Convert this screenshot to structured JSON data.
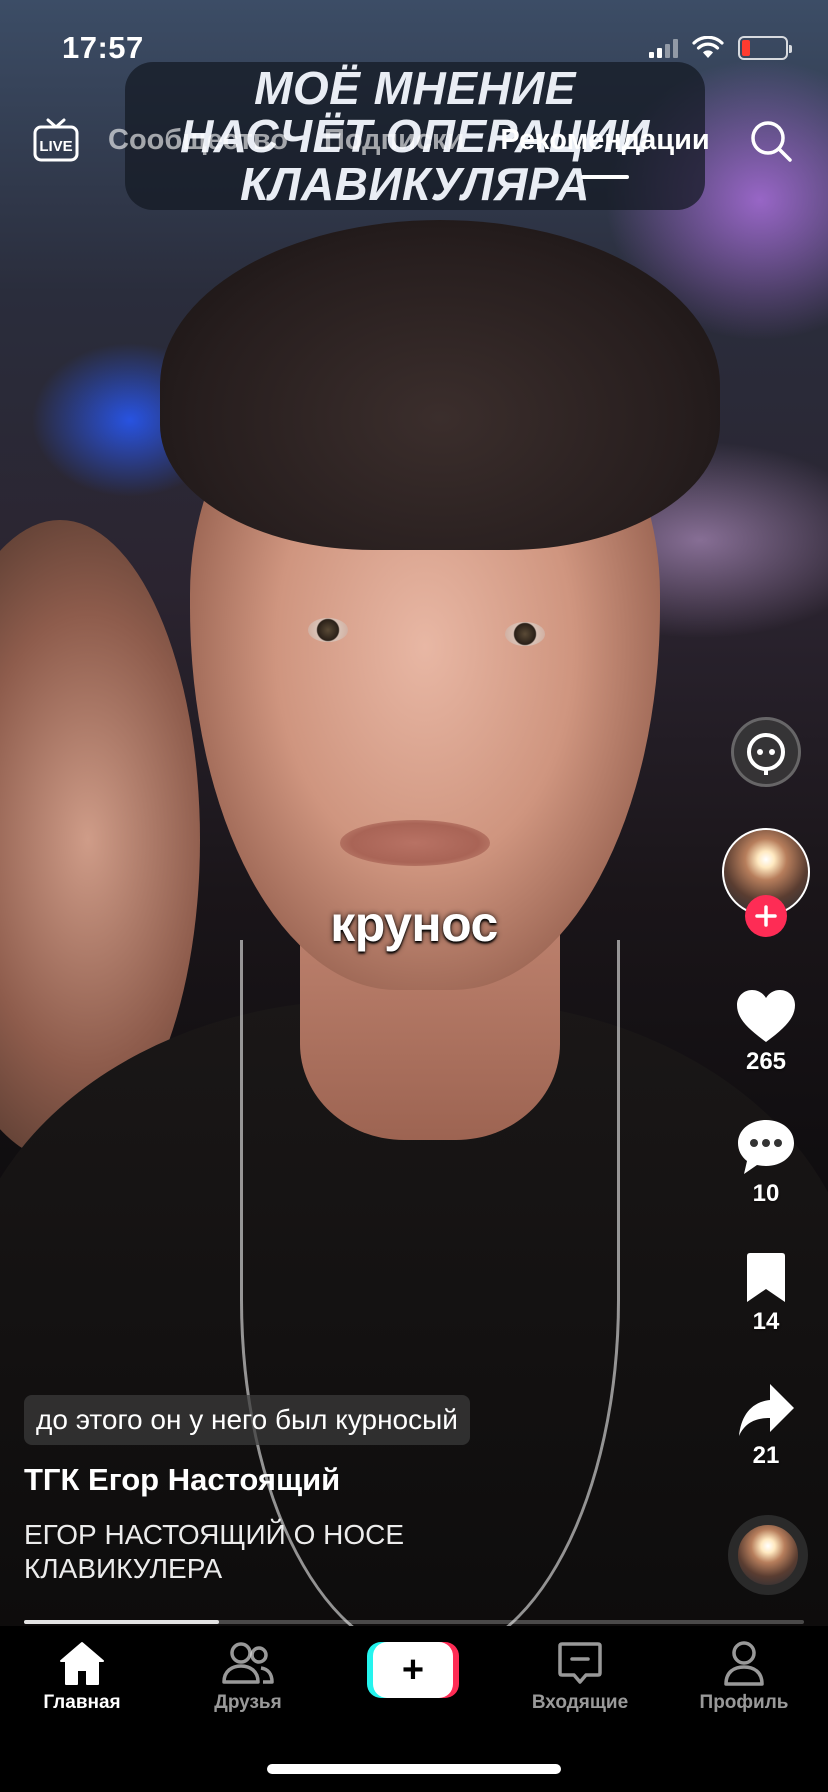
{
  "status_bar": {
    "time": "17:57"
  },
  "video_overlay": {
    "line1": "МОЁ МНЕНИЕ",
    "line2": "НАСЧЁТ ОПЕРАЦИИ",
    "line3": "КЛАВИКУЛЯРА"
  },
  "top_nav": {
    "live_label": "LIVE",
    "tabs": [
      {
        "label": "Сообщество"
      },
      {
        "label": "Подписки"
      },
      {
        "label": "Рекомендации"
      }
    ],
    "active_tab": "Рекомендации"
  },
  "caption_sticker": "крунос",
  "actions": {
    "likes": "265",
    "comments": "10",
    "bookmarks": "14",
    "shares": "21"
  },
  "comment_pill": "до этого он у него был курносый",
  "author": "ТГК Егор Настоящий",
  "description": "ЕГОР НАСТОЯЩИЙ О НОСЕ КЛАВИКУЛЕРА",
  "progress": 0.25,
  "tabbar": {
    "home": "Главная",
    "friends": "Друзья",
    "create": "+",
    "inbox": "Входящие",
    "profile": "Профиль"
  },
  "colors": {
    "accent_red": "#fe2c55",
    "accent_cyan": "#25f4ee",
    "battery_low": "#ff3b30"
  }
}
